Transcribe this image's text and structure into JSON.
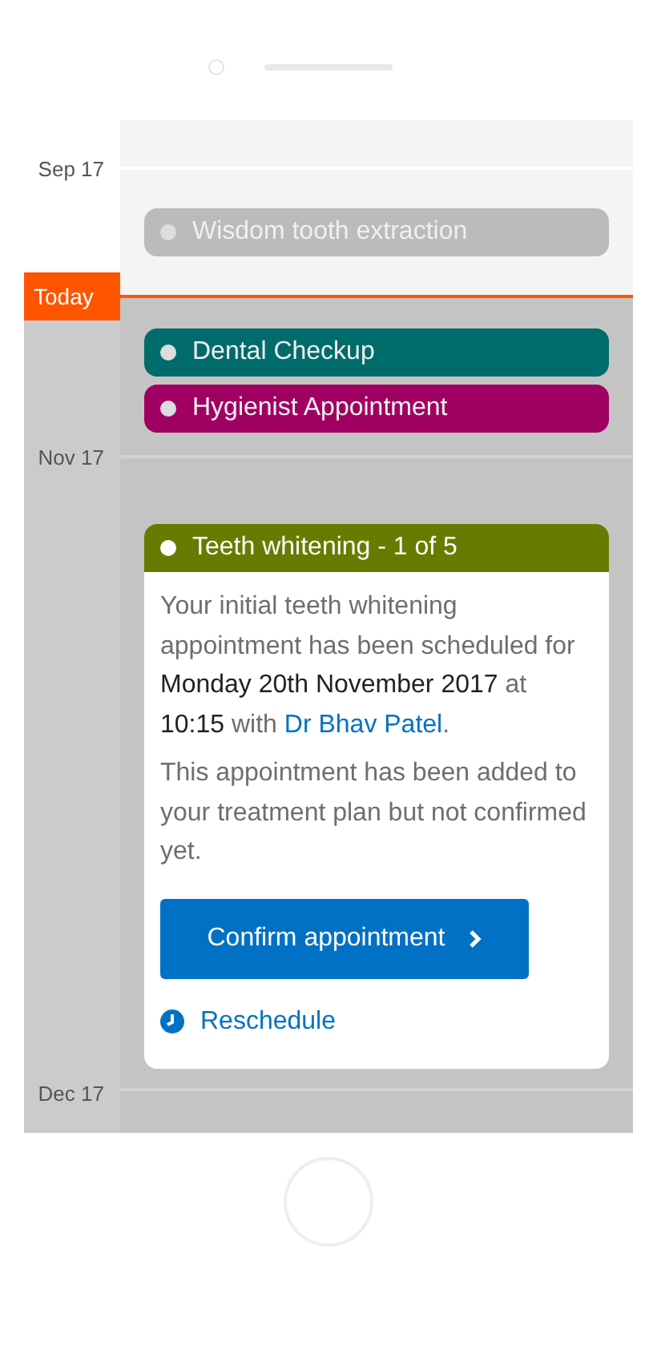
{
  "past": [
    {
      "kind": "month",
      "label": "Sep 17"
    },
    {
      "kind": "event",
      "title": "Wisdom tooth extraction",
      "color": "#bbbbbb"
    }
  ],
  "today": {
    "label": "Today"
  },
  "future": [
    {
      "kind": "event",
      "title": "Dental Checkup",
      "color": "#006b6b"
    },
    {
      "kind": "event",
      "title": "Hygienist Appointment",
      "color": "#a00062"
    },
    {
      "kind": "month",
      "label": "Nov 17"
    },
    {
      "kind": "card",
      "title": "Teeth whitening - 1 of 5",
      "color": "#687b00",
      "text": "Your initial teeth whitening appointment has been scheduled for **Monday 20th November 2017** at **10:15** with ",
      "link": "Dr Bhav Patel",
      "after": ".",
      "note": "This appointment has been added to your treatment plan but not confirmed yet.",
      "button": "Confirm appointment",
      "secondary": "Reschedule"
    },
    {
      "kind": "month",
      "label": "Dec 17"
    }
  ]
}
